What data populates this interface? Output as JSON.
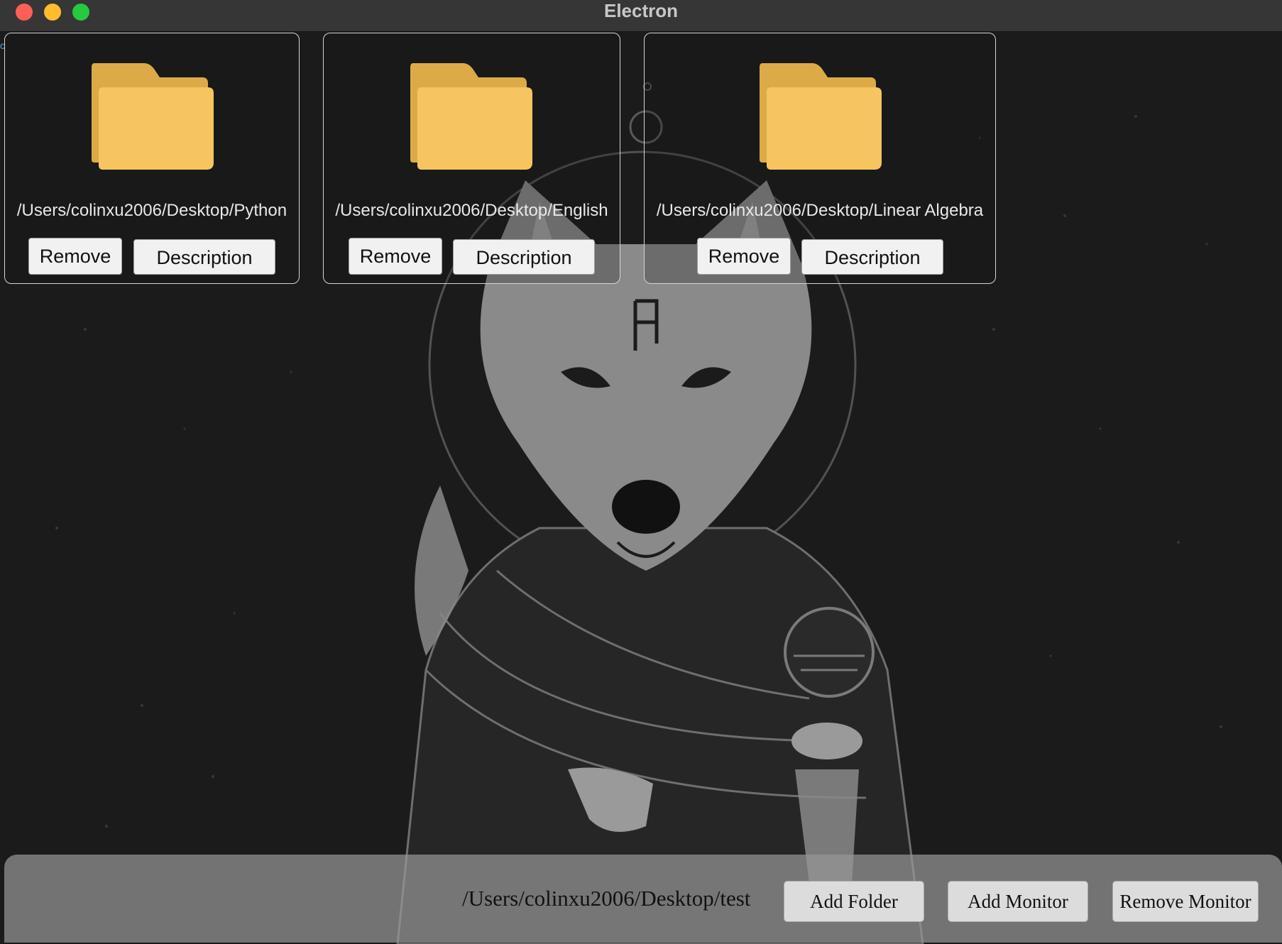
{
  "window": {
    "title": "Electron"
  },
  "folders": [
    {
      "path": "/Users/colinxu2006/Desktop/Python",
      "remove_label": "Remove",
      "description_label": "Description"
    },
    {
      "path": "/Users/colinxu2006/Desktop/English",
      "remove_label": "Remove",
      "description_label": "Description"
    },
    {
      "path": "/Users/colinxu2006/Desktop/Linear Algebra",
      "remove_label": "Remove",
      "description_label": "Description"
    }
  ],
  "bottom_bar": {
    "current_path": "/Users/colinxu2006/Desktop/test",
    "add_folder_label": "Add Folder",
    "add_monitor_label": "Add Monitor",
    "remove_monitor_label": "Remove Monitor"
  },
  "icons": {
    "folder": "folder-icon",
    "background": "wolf-illustration"
  },
  "colors": {
    "folder_front": "#f6c55f",
    "folder_back": "#dcab48",
    "close": "#ff5f57",
    "minimize": "#febc2e",
    "zoom": "#28c840"
  }
}
